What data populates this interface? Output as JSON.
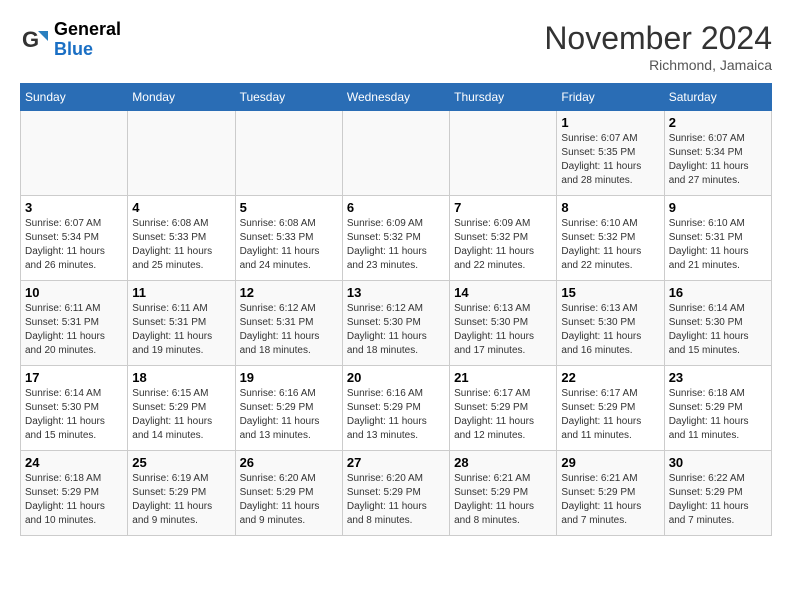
{
  "logo": {
    "line1": "General",
    "line2": "Blue"
  },
  "title": "November 2024",
  "location": "Richmond, Jamaica",
  "weekdays": [
    "Sunday",
    "Monday",
    "Tuesday",
    "Wednesday",
    "Thursday",
    "Friday",
    "Saturday"
  ],
  "weeks": [
    [
      {
        "day": "",
        "info": ""
      },
      {
        "day": "",
        "info": ""
      },
      {
        "day": "",
        "info": ""
      },
      {
        "day": "",
        "info": ""
      },
      {
        "day": "",
        "info": ""
      },
      {
        "day": "1",
        "info": "Sunrise: 6:07 AM\nSunset: 5:35 PM\nDaylight: 11 hours and 28 minutes."
      },
      {
        "day": "2",
        "info": "Sunrise: 6:07 AM\nSunset: 5:34 PM\nDaylight: 11 hours and 27 minutes."
      }
    ],
    [
      {
        "day": "3",
        "info": "Sunrise: 6:07 AM\nSunset: 5:34 PM\nDaylight: 11 hours and 26 minutes."
      },
      {
        "day": "4",
        "info": "Sunrise: 6:08 AM\nSunset: 5:33 PM\nDaylight: 11 hours and 25 minutes."
      },
      {
        "day": "5",
        "info": "Sunrise: 6:08 AM\nSunset: 5:33 PM\nDaylight: 11 hours and 24 minutes."
      },
      {
        "day": "6",
        "info": "Sunrise: 6:09 AM\nSunset: 5:32 PM\nDaylight: 11 hours and 23 minutes."
      },
      {
        "day": "7",
        "info": "Sunrise: 6:09 AM\nSunset: 5:32 PM\nDaylight: 11 hours and 22 minutes."
      },
      {
        "day": "8",
        "info": "Sunrise: 6:10 AM\nSunset: 5:32 PM\nDaylight: 11 hours and 22 minutes."
      },
      {
        "day": "9",
        "info": "Sunrise: 6:10 AM\nSunset: 5:31 PM\nDaylight: 11 hours and 21 minutes."
      }
    ],
    [
      {
        "day": "10",
        "info": "Sunrise: 6:11 AM\nSunset: 5:31 PM\nDaylight: 11 hours and 20 minutes."
      },
      {
        "day": "11",
        "info": "Sunrise: 6:11 AM\nSunset: 5:31 PM\nDaylight: 11 hours and 19 minutes."
      },
      {
        "day": "12",
        "info": "Sunrise: 6:12 AM\nSunset: 5:31 PM\nDaylight: 11 hours and 18 minutes."
      },
      {
        "day": "13",
        "info": "Sunrise: 6:12 AM\nSunset: 5:30 PM\nDaylight: 11 hours and 18 minutes."
      },
      {
        "day": "14",
        "info": "Sunrise: 6:13 AM\nSunset: 5:30 PM\nDaylight: 11 hours and 17 minutes."
      },
      {
        "day": "15",
        "info": "Sunrise: 6:13 AM\nSunset: 5:30 PM\nDaylight: 11 hours and 16 minutes."
      },
      {
        "day": "16",
        "info": "Sunrise: 6:14 AM\nSunset: 5:30 PM\nDaylight: 11 hours and 15 minutes."
      }
    ],
    [
      {
        "day": "17",
        "info": "Sunrise: 6:14 AM\nSunset: 5:30 PM\nDaylight: 11 hours and 15 minutes."
      },
      {
        "day": "18",
        "info": "Sunrise: 6:15 AM\nSunset: 5:29 PM\nDaylight: 11 hours and 14 minutes."
      },
      {
        "day": "19",
        "info": "Sunrise: 6:16 AM\nSunset: 5:29 PM\nDaylight: 11 hours and 13 minutes."
      },
      {
        "day": "20",
        "info": "Sunrise: 6:16 AM\nSunset: 5:29 PM\nDaylight: 11 hours and 13 minutes."
      },
      {
        "day": "21",
        "info": "Sunrise: 6:17 AM\nSunset: 5:29 PM\nDaylight: 11 hours and 12 minutes."
      },
      {
        "day": "22",
        "info": "Sunrise: 6:17 AM\nSunset: 5:29 PM\nDaylight: 11 hours and 11 minutes."
      },
      {
        "day": "23",
        "info": "Sunrise: 6:18 AM\nSunset: 5:29 PM\nDaylight: 11 hours and 11 minutes."
      }
    ],
    [
      {
        "day": "24",
        "info": "Sunrise: 6:18 AM\nSunset: 5:29 PM\nDaylight: 11 hours and 10 minutes."
      },
      {
        "day": "25",
        "info": "Sunrise: 6:19 AM\nSunset: 5:29 PM\nDaylight: 11 hours and 9 minutes."
      },
      {
        "day": "26",
        "info": "Sunrise: 6:20 AM\nSunset: 5:29 PM\nDaylight: 11 hours and 9 minutes."
      },
      {
        "day": "27",
        "info": "Sunrise: 6:20 AM\nSunset: 5:29 PM\nDaylight: 11 hours and 8 minutes."
      },
      {
        "day": "28",
        "info": "Sunrise: 6:21 AM\nSunset: 5:29 PM\nDaylight: 11 hours and 8 minutes."
      },
      {
        "day": "29",
        "info": "Sunrise: 6:21 AM\nSunset: 5:29 PM\nDaylight: 11 hours and 7 minutes."
      },
      {
        "day": "30",
        "info": "Sunrise: 6:22 AM\nSunset: 5:29 PM\nDaylight: 11 hours and 7 minutes."
      }
    ]
  ]
}
